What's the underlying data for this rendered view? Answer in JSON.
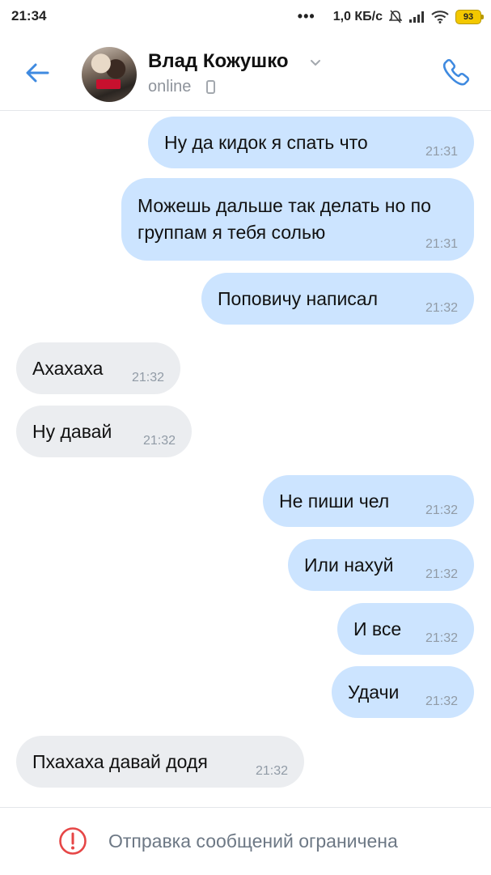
{
  "status_bar": {
    "time": "21:34",
    "dots": "•••",
    "net_speed": "1,0 КБ/с",
    "battery": "93"
  },
  "header": {
    "contact_name": "Влад Кожушко",
    "status": "online"
  },
  "messages": [
    {
      "dir": "out",
      "text": "Ну да кидок я спать что",
      "time": "21:31"
    },
    {
      "dir": "out",
      "text": "Можешь дальше так делать но по группам я тебя солью",
      "time": "21:31"
    },
    {
      "dir": "out",
      "text": "Поповичу написал",
      "time": "21:32"
    },
    {
      "dir": "in",
      "text": "Ахахаха",
      "time": "21:32"
    },
    {
      "dir": "in",
      "text": "Ну давай",
      "time": "21:32"
    },
    {
      "dir": "out",
      "text": "Не пиши чел",
      "time": "21:32"
    },
    {
      "dir": "out",
      "text": "Или нахуй",
      "time": "21:32"
    },
    {
      "dir": "out",
      "text": "И все",
      "time": "21:32"
    },
    {
      "dir": "out",
      "text": "Удачи",
      "time": "21:32"
    },
    {
      "dir": "in",
      "text": "Пхахаха давай додя",
      "time": "21:32"
    }
  ],
  "footer": {
    "notice": "Отправка сообщений ограничена"
  },
  "colors": {
    "accent": "#3f8ae0",
    "outgoing_bubble": "#cce4ff",
    "incoming_bubble": "#ebedf0",
    "warning": "#e64646"
  },
  "icons": {
    "back": "arrow-left-icon",
    "call": "phone-icon",
    "status_device": "mobile-phone-icon",
    "footer": "exclamation-circle-icon"
  }
}
